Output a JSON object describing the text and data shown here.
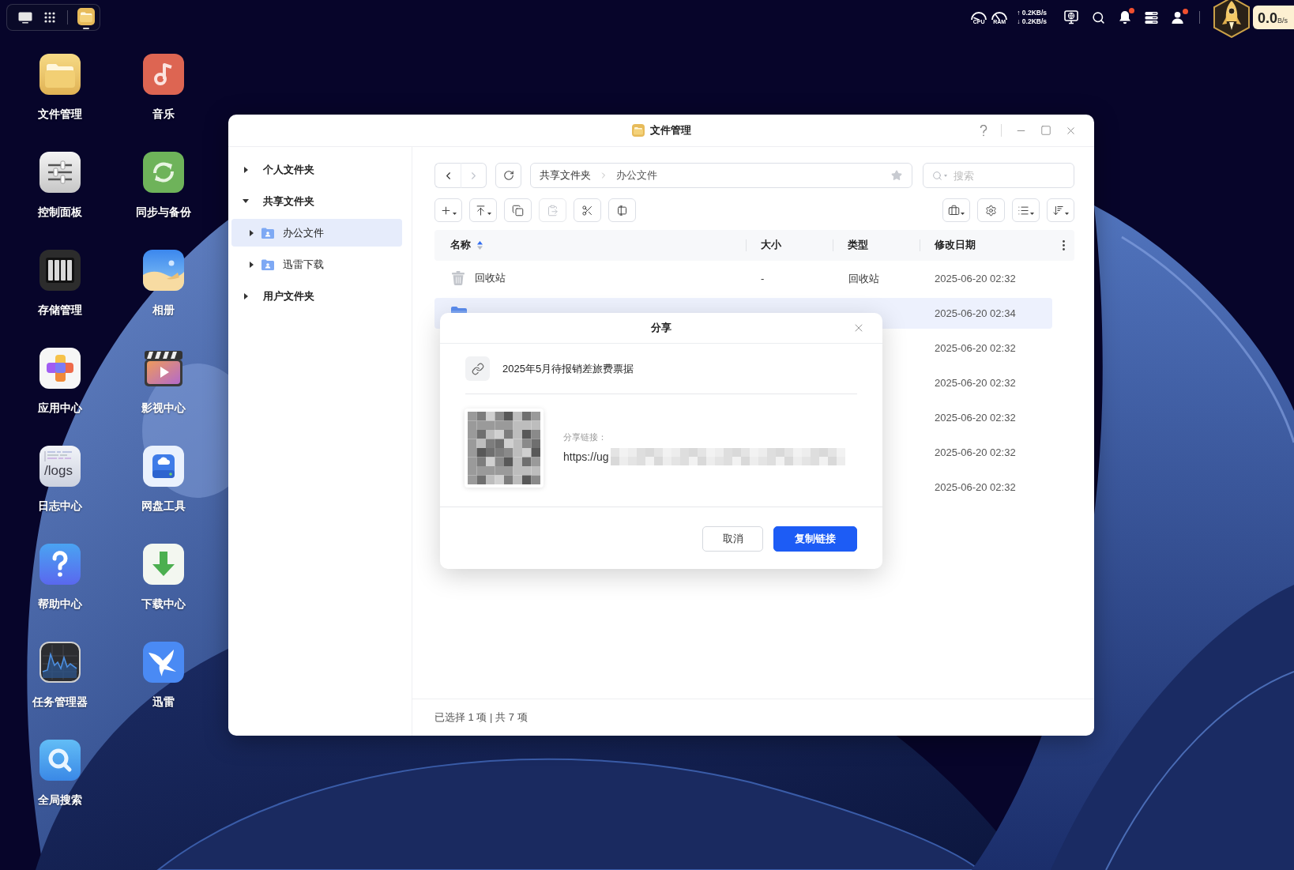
{
  "taskbar": {
    "apps": [
      {
        "kind": "files",
        "running": true
      }
    ]
  },
  "system_tray": {
    "meters": [
      {
        "kind": "cpu",
        "label": "CPU"
      },
      {
        "kind": "ram",
        "label": "RAM"
      }
    ],
    "upload": "↑ 0.2KB/s",
    "download": "↓ 0.2KB/s",
    "icons": [
      {
        "kind": "remote",
        "badge": false
      },
      {
        "kind": "search",
        "badge": false
      },
      {
        "kind": "bell",
        "badge": true
      },
      {
        "kind": "list",
        "badge": false
      },
      {
        "kind": "user",
        "badge": true
      }
    ],
    "speed": {
      "value": "0.0",
      "unit": "B/s"
    }
  },
  "desktop_icons": [
    {
      "kind": "files",
      "label": "文件管理"
    },
    {
      "kind": "music",
      "label": "音乐"
    },
    {
      "kind": "control",
      "label": "控制面板"
    },
    {
      "kind": "sync",
      "label": "同步与备份"
    },
    {
      "kind": "storage",
      "label": "存储管理"
    },
    {
      "kind": "photos",
      "label": "相册"
    },
    {
      "kind": "apps",
      "label": "应用中心"
    },
    {
      "kind": "video",
      "label": "影视中心"
    },
    {
      "kind": "logs",
      "label": "日志中心",
      "icon_text": "/logs"
    },
    {
      "kind": "netdisk",
      "label": "网盘工具"
    },
    {
      "kind": "help",
      "label": "帮助中心"
    },
    {
      "kind": "download",
      "label": "下载中心"
    },
    {
      "kind": "taskmgr",
      "label": "任务管理器"
    },
    {
      "kind": "xunlei",
      "label": "迅雷"
    },
    {
      "kind": "search",
      "label": "全局搜索"
    }
  ],
  "window": {
    "title": "文件管理",
    "sidebar": {
      "items": [
        {
          "label": "个人文件夹",
          "expanded": false,
          "selected": false
        },
        {
          "label": "共享文件夹",
          "expanded": true,
          "selected": false,
          "children": [
            {
              "label": "办公文件",
              "expanded": false,
              "selected": true
            },
            {
              "label": "迅雷下载",
              "expanded": false,
              "selected": false
            }
          ]
        },
        {
          "label": "用户文件夹",
          "expanded": false,
          "selected": false
        }
      ]
    },
    "toolbar": {
      "history": [
        {
          "kind": "back",
          "disabled": false
        },
        {
          "kind": "forward",
          "disabled": true
        }
      ],
      "path": {
        "segments": [
          "共享文件夹",
          "办公文件"
        ],
        "favorite": false
      },
      "search": {
        "placeholder": "搜索"
      },
      "actions": [
        {
          "kind": "new",
          "dropdown": true,
          "disabled": false
        },
        {
          "kind": "upload",
          "dropdown": true,
          "disabled": false
        },
        {
          "kind": "copy",
          "dropdown": false,
          "disabled": false
        },
        {
          "kind": "paste",
          "dropdown": false,
          "disabled": true
        },
        {
          "kind": "cut",
          "dropdown": false,
          "disabled": false
        },
        {
          "kind": "rename",
          "dropdown": false,
          "disabled": false
        }
      ],
      "view_actions": [
        {
          "kind": "tools",
          "dropdown": true
        },
        {
          "kind": "settings",
          "dropdown": false
        },
        {
          "kind": "view",
          "dropdown": true
        },
        {
          "kind": "sort",
          "dropdown": true
        }
      ]
    },
    "table": {
      "columns": [
        {
          "label": "名称",
          "sorted": true
        },
        {
          "label": "大小",
          "sorted": false
        },
        {
          "label": "类型",
          "sorted": false
        },
        {
          "label": "修改日期",
          "sorted": false
        }
      ],
      "rows": [
        {
          "kind": "trash",
          "name": "回收站",
          "size": "-",
          "type": "回收站",
          "modified": "2025-06-20 02:32",
          "selected": false
        },
        {
          "kind": "folder",
          "modified": "2025-06-20 02:34",
          "selected": true
        },
        {
          "modified": "2025-06-20 02:32",
          "selected": false
        },
        {
          "modified": "2025-06-20 02:32",
          "selected": false
        },
        {
          "modified": "2025-06-20 02:32",
          "selected": false
        },
        {
          "modified": "2025-06-20 02:32",
          "selected": false
        },
        {
          "modified": "2025-06-20 02:32",
          "selected": false
        }
      ]
    },
    "status_bar": "已选择 1 项 | 共 7 项"
  },
  "dialog": {
    "title": "分享",
    "item_name": "2025年5月待报销差旅费票据",
    "link_label": "分享链接：",
    "link": "https://ug",
    "buttons": [
      {
        "kind": "secondary",
        "label": "取消"
      },
      {
        "kind": "primary",
        "label": "复制链接"
      }
    ]
  }
}
